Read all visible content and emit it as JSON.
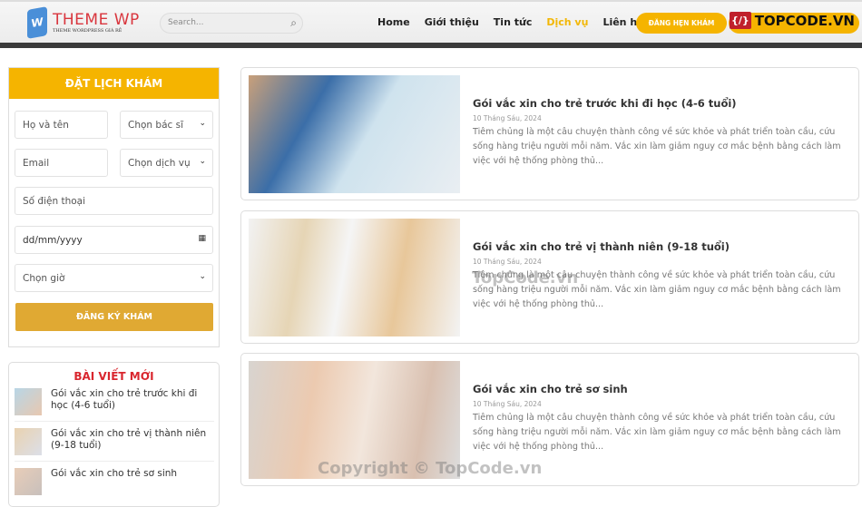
{
  "header": {
    "logo_main": "THEME WP",
    "logo_sub": "THEME WORDPRESS GIÁ RẺ",
    "search_placeholder": "Search...",
    "nav": [
      "Home",
      "Giới thiệu",
      "Tin tức",
      "Dịch vụ",
      "Liên hệ"
    ],
    "active_nav": "Dịch vụ",
    "book_button": "ĐĂNG HẸN KHÁM",
    "topcode_logo": "TOPCODE.VN"
  },
  "form": {
    "title": "ĐẶT LỊCH KHÁM",
    "name_placeholder": "Họ và tên",
    "doctor_select": "Chọn bác sĩ",
    "email_placeholder": "Email",
    "service_select": "Chọn dịch vụ",
    "phone_placeholder": "Số điện thoại",
    "date_placeholder": "dd/mm/yyyy",
    "time_select": "Chọn giờ",
    "submit": "ĐĂNG KÝ KHÁM"
  },
  "recent": {
    "title": "BÀI VIẾT MỚI",
    "items": [
      "Gói vắc xin cho trẻ trước khi đi học (4-6 tuổi)",
      "Gói vắc xin cho trẻ vị thành niên (9-18 tuổi)",
      "Gói vắc xin cho trẻ sơ sinh"
    ]
  },
  "posts": [
    {
      "title": "Gói vắc xin cho trẻ trước khi đi học (4-6 tuổi)",
      "date": "10 Tháng Sáu, 2024",
      "excerpt": "Tiêm chủng là một câu chuyện thành công về sức khỏe và phát triển toàn cầu, cứu sống hàng triệu người mỗi năm. Vắc xin làm giảm nguy cơ mắc bệnh bằng cách làm việc với hệ thống phòng thủ..."
    },
    {
      "title": "Gói vắc xin cho trẻ vị thành niên (9-18 tuổi)",
      "date": "10 Tháng Sáu, 2024",
      "excerpt": "Tiêm chủng là một câu chuyện thành công về sức khỏe và phát triển toàn cầu, cứu sống hàng triệu người mỗi năm. Vắc xin làm giảm nguy cơ mắc bệnh bằng cách làm việc với hệ thống phòng thủ..."
    },
    {
      "title": "Gói vắc xin cho trẻ sơ sinh",
      "date": "10 Tháng Sáu, 2024",
      "excerpt": "Tiêm chủng là một câu chuyện thành công về sức khỏe và phát triển toàn cầu, cứu sống hàng triệu người mỗi năm. Vắc xin làm giảm nguy cơ mắc bệnh bằng cách làm việc với hệ thống phòng thủ..."
    }
  ],
  "watermarks": {
    "center": "TopCode.vn",
    "bottom": "Copyright © TopCode.vn"
  }
}
